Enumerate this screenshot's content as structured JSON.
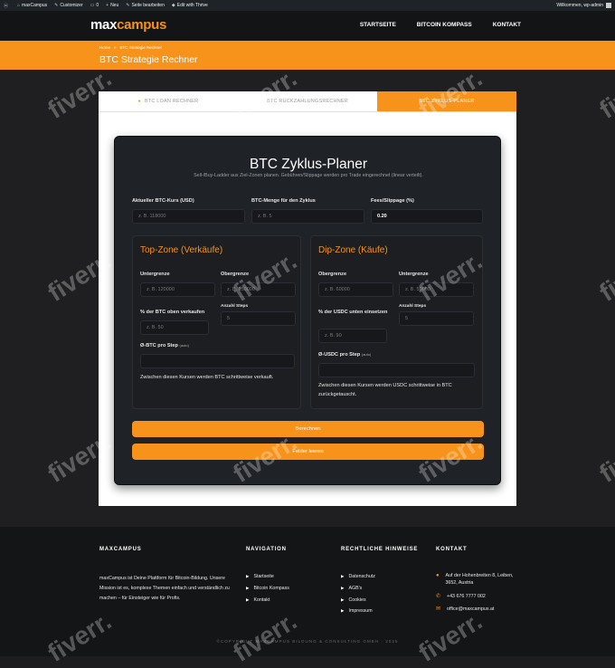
{
  "adminbar": {
    "items": [
      "maxCampus",
      "Customizer",
      "0",
      "Neu",
      "Seite bearbeiten",
      "Edit with Thrive"
    ],
    "greeting": "Willkommen, wp-admin"
  },
  "header": {
    "logo_a": "max",
    "logo_b": "campus",
    "nav": [
      "STARTSEITE",
      "BITCOIN KOMPASS",
      "KONTAKT"
    ]
  },
  "banner": {
    "crumb_home": "Home",
    "crumb_sep": "»",
    "crumb_current": "BTC Strategie Rechner",
    "title": "BTC Strategie Rechner"
  },
  "tabs": [
    "BTC LOAN RECHNER",
    "BTC RÜCKZAHLUNGSRECHNER",
    "BTC ZYKLUS-PLANER"
  ],
  "planner": {
    "title": "BTC Zyklus-Planer",
    "subtitle": "Sell-/Buy-Ladder aus Ziel-Zonen planen. Gebühren/Slippage werden pro Trade eingerechnet (linear verteilt).",
    "price_label": "Aktueller BTC-Kurs (USD)",
    "price_placeholder": "z. B. 118000",
    "amount_label": "BTC-Menge für den Zyklus",
    "amount_placeholder": "z. B. 5",
    "fees_label": "Fees/Slippage (%)",
    "fees_value": "0.20",
    "top": {
      "title": "Top-Zone (Verkäufe)",
      "lower_label": "Untergrenze",
      "lower_placeholder": "z. B. 120000",
      "upper_label": "Obergrenze",
      "upper_placeholder": "z. B. 150000",
      "pct_label": "% der BTC oben verkaufen",
      "pct_placeholder": "z. B. 50",
      "steps_label": "Anzahl Steps",
      "steps_placeholder": "5",
      "per_step_label": "Ø-BTC pro Step",
      "per_step_hint": "(auto)",
      "note": "Zwischen diesen Kursen werden BTC schrittweise verkauft."
    },
    "dip": {
      "title": "Dip-Zone (Käufe)",
      "upper_label": "Obergrenze",
      "upper_placeholder": "z. B. 60000",
      "lower_label": "Untergrenze",
      "lower_placeholder": "z. B. 50000",
      "pct_label": "% der USDC unten einsetzen",
      "pct_placeholder": "z. B. 90",
      "steps_label": "Anzahl Steps",
      "steps_placeholder": "5",
      "per_step_label": "Ø-USDC pro Step",
      "per_step_hint": "(auto)",
      "note": "Zwischen diesen Kursen werden USDC schrittweise in BTC zurückgetauscht."
    },
    "calc_button": "Berechnen",
    "clear_button": "Felder leeren"
  },
  "footer": {
    "col1_title": "MAXCAMPUS",
    "col1_text": "maxCampus ist Deine Plattform für Bitcoin-Bildung. Unsere Mission ist es, komplexe Themen einfach und verständlich zu machen – für Einsteiger wie für Profis.",
    "col2_title": "NAVIGATION",
    "col2_links": [
      "Startseite",
      "Bitcoin Kompass",
      "Kontakt"
    ],
    "col3_title": "RECHTLICHE HINWEISE",
    "col3_links": [
      "Datenschutz",
      "AGB's",
      "Cookies",
      "Impressum"
    ],
    "col4_title": "KONTAKT",
    "address": "Auf der Hohenbreiten 8, Leiben, 3652, Austria",
    "phone": "+43 676 7777 002",
    "email": "office@maxcampus.at",
    "copyright": "©COPYRIGHT MAXCAMPUS BILDUNG & CONSULTING GMBH · 2025"
  },
  "watermark": "fiverr.",
  "colors": {
    "accent": "#f7931a",
    "bg_dark": "#1f1f21",
    "panel": "#1f2227"
  },
  "icons": [
    "wordpress-icon",
    "home-icon",
    "brush-icon",
    "comment-icon",
    "plus-icon",
    "pencil-icon",
    "thrive-icon",
    "pin-icon",
    "phone-icon",
    "mail-icon"
  ]
}
